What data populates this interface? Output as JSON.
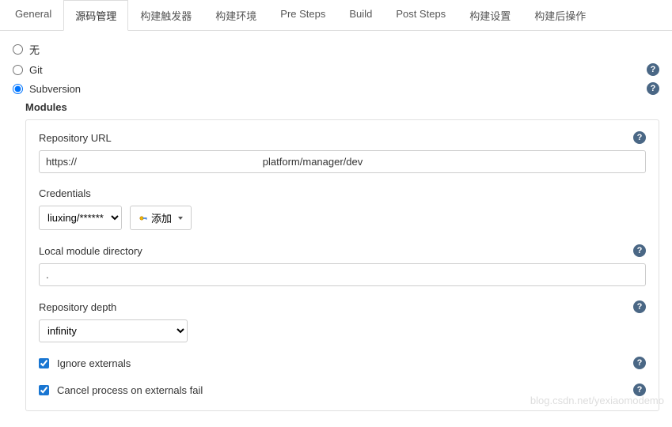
{
  "tabs": [
    {
      "label": "General"
    },
    {
      "label": "源码管理"
    },
    {
      "label": "构建触发器"
    },
    {
      "label": "构建环境"
    },
    {
      "label": "Pre Steps"
    },
    {
      "label": "Build"
    },
    {
      "label": "Post Steps"
    },
    {
      "label": "构建设置"
    },
    {
      "label": "构建后操作"
    }
  ],
  "scm": {
    "none_label": "无",
    "git_label": "Git",
    "svn_label": "Subversion",
    "selected": "Subversion"
  },
  "modules": {
    "heading": "Modules",
    "repo_url_label": "Repository URL",
    "repo_url_value": "https://                                                                 platform/manager/dev",
    "credentials_label": "Credentials",
    "credentials_value": "liuxing/******",
    "add_button_label": "添加",
    "local_dir_label": "Local module directory",
    "local_dir_value": ".",
    "depth_label": "Repository depth",
    "depth_value": "infinity",
    "ignore_externals_label": "Ignore externals",
    "ignore_externals_checked": true,
    "cancel_on_fail_label": "Cancel process on externals fail",
    "cancel_on_fail_checked": true
  },
  "help_glyph": "?",
  "watermark": "blog.csdn.net/yexiaomodemo"
}
